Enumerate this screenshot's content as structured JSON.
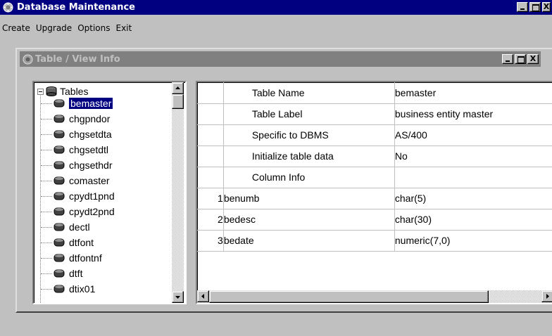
{
  "app": {
    "title": "Database Maintenance",
    "icon": "database-maintenance-icon",
    "close_glyph": "X"
  },
  "menu": [
    {
      "label": "Create"
    },
    {
      "label": "Upgrade"
    },
    {
      "label": "Options"
    },
    {
      "label": "Exit"
    }
  ],
  "child": {
    "title": "Table / View Info",
    "close_glyph": "X"
  },
  "tree": {
    "root_label": "Tables",
    "selected": "bemaster",
    "items": [
      {
        "label": "bemaster"
      },
      {
        "label": "chgpndor"
      },
      {
        "label": "chgsetdta"
      },
      {
        "label": "chgsetdtl"
      },
      {
        "label": "chgsethdr"
      },
      {
        "label": "comaster"
      },
      {
        "label": "cpydt1pnd"
      },
      {
        "label": "cpydt2pnd"
      },
      {
        "label": "dectl"
      },
      {
        "label": "dtfont"
      },
      {
        "label": "dtfontnf"
      },
      {
        "label": "dtft"
      },
      {
        "label": "dtix01"
      }
    ]
  },
  "grid": {
    "properties": [
      {
        "name": "Table Name",
        "value": "bemaster"
      },
      {
        "name": "Table Label",
        "value": "business entity master"
      },
      {
        "name": "Specific to DBMS",
        "value": "AS/400"
      },
      {
        "name": "Initialize table data",
        "value": "No"
      },
      {
        "name": "Column Info",
        "value": ""
      }
    ],
    "columns": [
      {
        "num": "1",
        "name": "benumb",
        "type": "char(5)"
      },
      {
        "num": "2",
        "name": "bedesc",
        "type": "char(30)"
      },
      {
        "num": "3",
        "name": "bedate",
        "type": "numeric(7,0)"
      }
    ]
  },
  "colors": {
    "active_title": "#000080",
    "inactive_title": "#808080",
    "face": "#c0c0c0",
    "selection": "#000080"
  }
}
